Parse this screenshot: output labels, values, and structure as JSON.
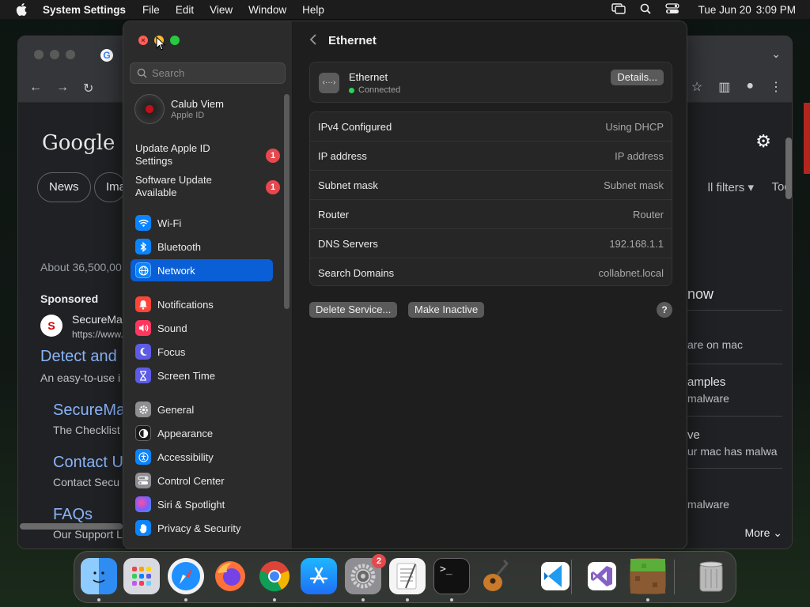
{
  "menubar": {
    "app_name": "System Settings",
    "menus": [
      "File",
      "Edit",
      "View",
      "Window",
      "Help"
    ],
    "clock_date": "Tue Jun 20",
    "clock_time": "3:09 PM",
    "status_icons": [
      "screen-mirroring-icon",
      "search-icon",
      "control-center-icon"
    ]
  },
  "browser": {
    "logo": "Google",
    "chips": [
      "News",
      "Ima"
    ],
    "all_filters": "ll filters ▾",
    "tools": "Tool",
    "about": "About 36,500,00",
    "sponsored": "Sponsored",
    "ad_name": "SecureMa",
    "ad_url": "https://www.",
    "results": [
      {
        "title": "Detect and",
        "desc": "An easy-to-use i"
      },
      {
        "title": "SecureMa",
        "desc": "The Checklist"
      },
      {
        "title": "Contact U",
        "desc": "Contact Secu"
      },
      {
        "title": "FAQs",
        "desc": "Our Support L"
      }
    ],
    "right_panel": [
      {
        "title": "now",
        "sub": ""
      },
      {
        "title": "",
        "sub": "are on mac"
      },
      {
        "title": "amples",
        "sub": "malware"
      },
      {
        "title": "ve",
        "sub": "ur mac has malwa"
      },
      {
        "title": "",
        "sub": "malware"
      }
    ],
    "more": "More"
  },
  "settings": {
    "search_placeholder": "Search",
    "account": {
      "name": "Calub Viem",
      "sub": "Apple ID"
    },
    "alerts": [
      {
        "label": "Update Apple ID Settings",
        "badge": "1"
      },
      {
        "label": "Software Update Available",
        "badge": "1"
      }
    ],
    "sidebar_groups": [
      [
        {
          "label": "Wi-Fi",
          "icon": "wifi-icon",
          "color": "#0a84ff"
        },
        {
          "label": "Bluetooth",
          "icon": "bluetooth-icon",
          "color": "#0a84ff"
        },
        {
          "label": "Network",
          "icon": "globe-icon",
          "color": "#0a84ff",
          "active": true
        }
      ],
      [
        {
          "label": "Notifications",
          "icon": "bell-icon",
          "color": "#ff453a"
        },
        {
          "label": "Sound",
          "icon": "speaker-icon",
          "color": "#ff375f"
        },
        {
          "label": "Focus",
          "icon": "moon-icon",
          "color": "#5e5ce6"
        },
        {
          "label": "Screen Time",
          "icon": "hourglass-icon",
          "color": "#5e5ce6"
        }
      ],
      [
        {
          "label": "General",
          "icon": "gear-icon",
          "color": "#8e8e93"
        },
        {
          "label": "Appearance",
          "icon": "appearance-icon",
          "color": "#1c1c1e"
        },
        {
          "label": "Accessibility",
          "icon": "accessibility-icon",
          "color": "#0a84ff"
        },
        {
          "label": "Control Center",
          "icon": "toggles-icon",
          "color": "#8e8e93"
        },
        {
          "label": "Siri & Spotlight",
          "icon": "siri-icon",
          "color": "#bf5af2"
        },
        {
          "label": "Privacy & Security",
          "icon": "hand-icon",
          "color": "#0a84ff"
        }
      ]
    ],
    "detail": {
      "title": "Ethernet",
      "service_name": "Ethernet",
      "service_status": "Connected",
      "details_button": "Details...",
      "rows": [
        {
          "key": "IPv4 Configured",
          "value": "Using DHCP"
        },
        {
          "key": "IP address",
          "value": "IP address"
        },
        {
          "key": "Subnet mask",
          "value": "Subnet mask"
        },
        {
          "key": "Router",
          "value": "Router"
        },
        {
          "key": "DNS Servers",
          "value": "192.168.1.1"
        },
        {
          "key": "Search Domains",
          "value": "collabnet.local"
        }
      ],
      "delete_button": "Delete Service...",
      "inactive_button": "Make Inactive",
      "help_button": "?"
    }
  },
  "dock": {
    "apps": [
      {
        "name": "Finder",
        "icon": "finder-icon",
        "color": "#2f8cf2",
        "running": true
      },
      {
        "name": "Launchpad",
        "icon": "launchpad-icon",
        "color": "#d9d9e0",
        "running": false
      },
      {
        "name": "Safari",
        "icon": "safari-icon",
        "color": "#1e90ff",
        "running": true
      },
      {
        "name": "Firefox",
        "icon": "firefox-icon",
        "color": "#ff7139",
        "running": false
      },
      {
        "name": "Chrome",
        "icon": "chrome-icon",
        "color": "#ffffff",
        "running": true
      },
      {
        "name": "App Store",
        "icon": "app-store-icon",
        "color": "#1e88f5",
        "running": false
      },
      {
        "name": "System Settings",
        "icon": "system-settings-icon",
        "color": "#8e8e93",
        "running": true,
        "badge": "2"
      },
      {
        "name": "TextEdit",
        "icon": "textedit-icon",
        "color": "#f5f5f5",
        "running": true
      },
      {
        "name": "Terminal",
        "icon": "terminal-icon",
        "color": "#111111",
        "running": true
      },
      {
        "name": "GarageBand",
        "icon": "garageband-icon",
        "color": "#6e4b2a",
        "running": false
      },
      {
        "name": "Visual Studio Code",
        "icon": "vscode-icon",
        "color": "#ffffff",
        "running": false
      },
      {
        "name": "Visual Studio",
        "icon": "visual-studio-icon",
        "color": "#ffffff",
        "running": false
      },
      {
        "name": "Minecraft",
        "icon": "minecraft-icon",
        "color": "#5a8a3a",
        "running": true
      },
      {
        "name": "Trash",
        "icon": "trash-icon",
        "color": "#9a9a9a",
        "running": false
      }
    ]
  }
}
